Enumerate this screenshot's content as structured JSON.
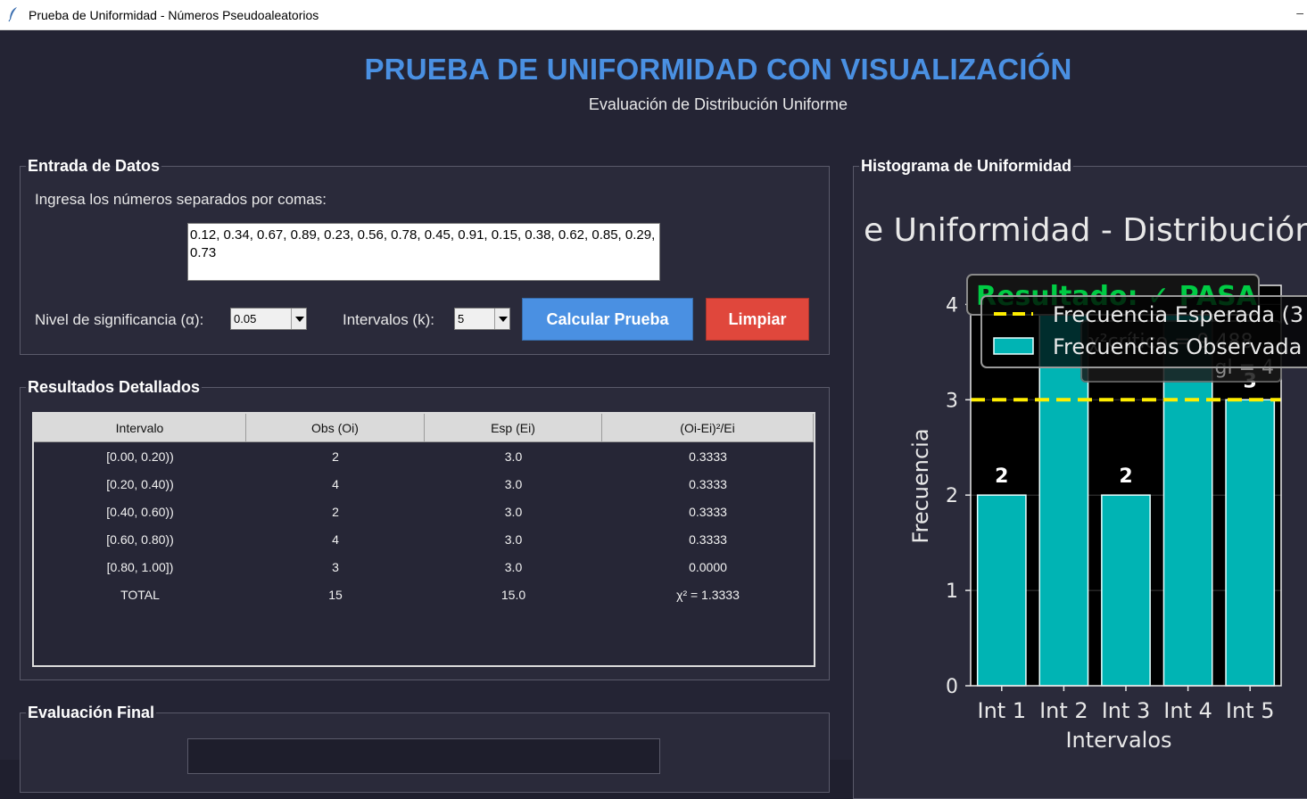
{
  "window": {
    "title": "Prueba de Uniformidad - Números Pseudoaleatorios",
    "app_icon": "feather-icon",
    "minimize_glyph": "–"
  },
  "header": {
    "title": "PRUEBA DE UNIFORMIDAD CON VISUALIZACIÓN",
    "subtitle": "Evaluación de Distribución Uniforme"
  },
  "input_section": {
    "legend": "Entrada de Datos",
    "prompt": "Ingresa los números separados por comas:",
    "numbers_value": "0.12, 0.34, 0.67, 0.89, 0.23, 0.56, 0.78, 0.45, 0.91, 0.15, 0.38, 0.62, 0.85, 0.29, 0.73",
    "alpha_label": "Nivel de significancia (α):",
    "alpha_value": "0.05",
    "intervals_label": "Intervalos (k):",
    "intervals_value": "5",
    "calc_button": "Calcular Prueba",
    "clear_button": "Limpiar"
  },
  "results_section": {
    "legend": "Resultados Detallados",
    "columns": [
      "Intervalo",
      "Obs (Oi)",
      "Esp (Ei)",
      "(Oi-Ei)²/Ei"
    ],
    "rows": [
      [
        "[0.00, 0.20))",
        "2",
        "3.0",
        "0.3333"
      ],
      [
        "[0.20, 0.40))",
        "4",
        "3.0",
        "0.3333"
      ],
      [
        "[0.40, 0.60))",
        "2",
        "3.0",
        "0.3333"
      ],
      [
        "[0.60, 0.80))",
        "4",
        "3.0",
        "0.3333"
      ],
      [
        "[0.80, 1.00])",
        "3",
        "3.0",
        "0.0000"
      ],
      [
        "TOTAL",
        "15",
        "15.0",
        "χ² = 1.3333"
      ]
    ]
  },
  "evaluation_section": {
    "legend": "Evaluación Final"
  },
  "histogram_section": {
    "legend": "Histograma de Uniformidad"
  },
  "chart_data": {
    "type": "bar",
    "title": "e Uniformidad - Distribución d",
    "xlabel": "Intervalos",
    "ylabel": "Frecuencia",
    "categories": [
      "Int 1",
      "Int 2",
      "Int 3",
      "Int 4",
      "Int 5"
    ],
    "values": [
      2,
      4,
      2,
      4,
      3
    ],
    "bar_labels": [
      "2",
      "4",
      "2",
      "4",
      "3"
    ],
    "expected": 3,
    "ylim": [
      0,
      4.2
    ],
    "yticks": [
      0,
      1,
      2,
      3,
      4
    ],
    "grid": true,
    "legend_position": "top-right",
    "legend": [
      "Frecuencia Esperada (3",
      "Frecuencias Observada"
    ],
    "result_text": "Resultado: ✓ PASA",
    "stats_text": [
      "χ²crítico = 9.488",
      "gl = 4"
    ],
    "colors": {
      "bar": "#00b4b4",
      "expected_line": "#ffee00",
      "axes_bg": "#000000",
      "figure_bg": "#242434",
      "text": "#e8e8e8",
      "result_text": "#00cc44"
    }
  }
}
